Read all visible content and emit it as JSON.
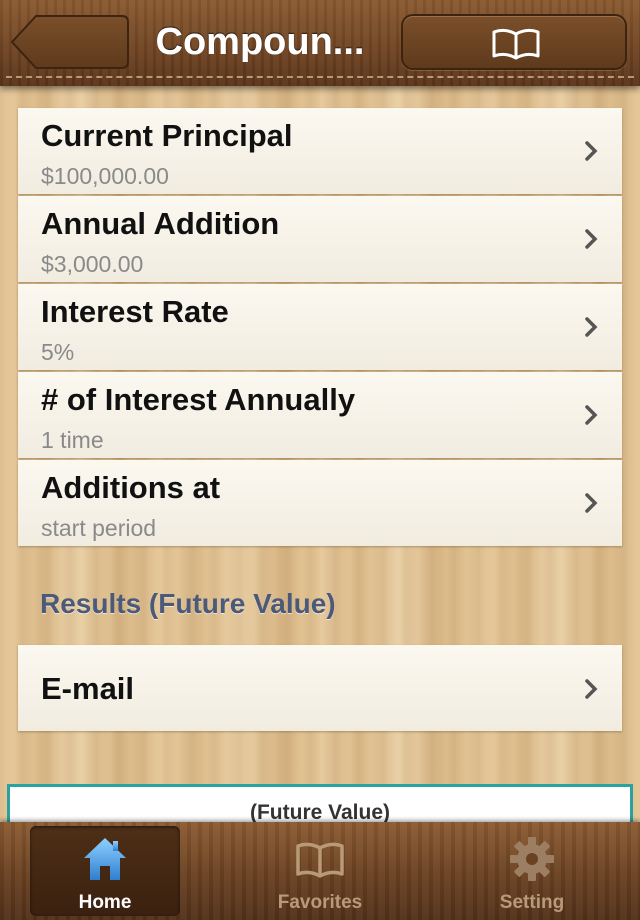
{
  "navbar": {
    "title": "Compoun...",
    "back_icon": "back-arrow-icon",
    "book_icon": "book-icon"
  },
  "rows": [
    {
      "label": "Current Principal",
      "value": "$100,000.00"
    },
    {
      "label": "Annual Addition",
      "value": "$3,000.00"
    },
    {
      "label": "Interest Rate",
      "value": "5%"
    },
    {
      "label": "# of Interest Annually",
      "value": "1 time"
    },
    {
      "label": "Additions at",
      "value": "start period"
    }
  ],
  "results": {
    "header": "Results (Future Value)",
    "email_label": "E-mail",
    "future_value_text": "(Future Value)"
  },
  "tabbar": {
    "items": [
      {
        "label": "Home",
        "icon": "home-icon",
        "active": true
      },
      {
        "label": "Favorites",
        "icon": "book-icon",
        "active": false
      },
      {
        "label": "Setting",
        "icon": "gear-icon",
        "active": false
      }
    ]
  },
  "colors": {
    "accent_teal": "#2aa2a0",
    "section_header": "#4a5a78",
    "home_icon_blue": "#4aa3e8"
  }
}
